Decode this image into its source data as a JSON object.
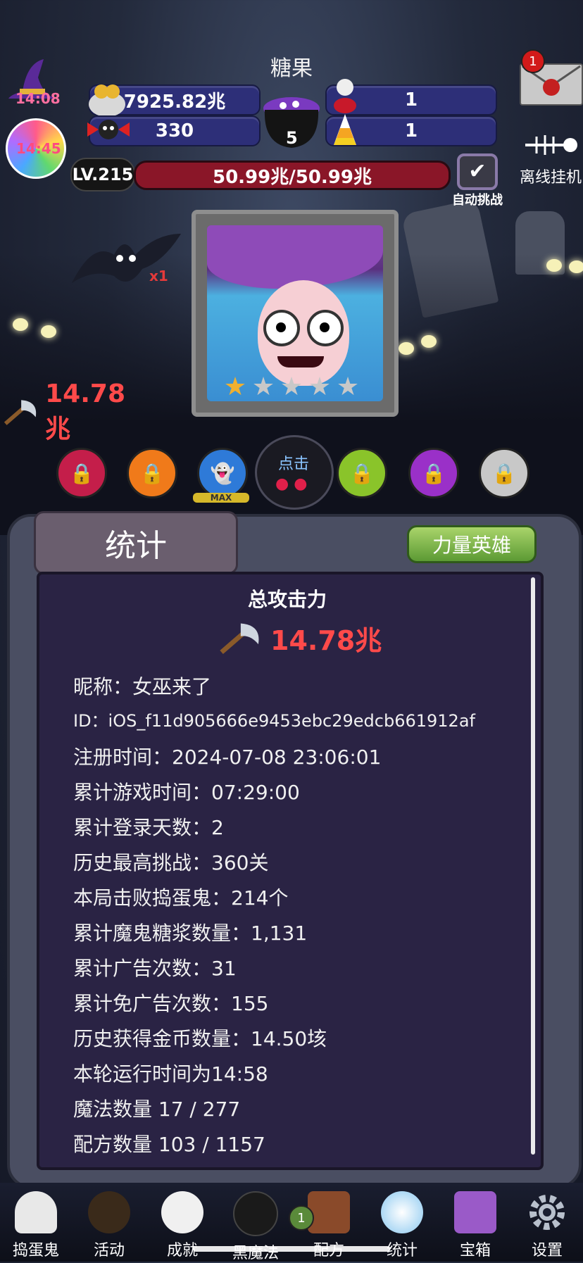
{
  "header": {
    "title": "糖果",
    "hat_timer": "14:08",
    "candy_timer": "14:45",
    "gold": "7925.82兆",
    "skull_candy": "330",
    "potion_count": "1",
    "candy_corn_count": "1",
    "cauldron_count": "5",
    "mail_badge": "1",
    "offline_label": "离线挂机",
    "level": "LV.215",
    "hp": "50.99兆/50.99兆",
    "auto_label": "自动挑战",
    "bat_multiplier": "x1",
    "attack": "14.78兆"
  },
  "hero_select": {
    "max_label": "MAX",
    "tap_label": "点击"
  },
  "stats_panel": {
    "tab_label": "统计",
    "hero_button": "力量英雄",
    "total_attack_title": "总攻击力",
    "total_attack_value": "14.78兆",
    "lines": [
      "昵称：女巫来了",
      "ID：iOS_f11d905666e9453ebc29edcb661912af",
      "注册时间：2024-07-08 23:06:01",
      "累计游戏时间：07:29:00",
      "累计登录天数：2",
      "历史最高挑战：360关",
      "本局击败捣蛋鬼：214个",
      "累计魔鬼糖浆数量：1,131",
      "累计广告次数：31",
      "累计免广告次数：155",
      "历史获得金币数量：14.50垓",
      "本轮运行时间为14:58",
      "魔法数量 17 / 277",
      "配方数量 103 / 1157"
    ]
  },
  "nav": {
    "items": [
      "捣蛋鬼",
      "活动",
      "成就",
      "黑魔法",
      "配方",
      "统计",
      "宝箱",
      "设置"
    ],
    "recipe_badge": "1"
  },
  "colors": {
    "accent_red": "#ff4a4a",
    "panel_bg": "#2a2344",
    "green_button": "#7bb24a"
  }
}
